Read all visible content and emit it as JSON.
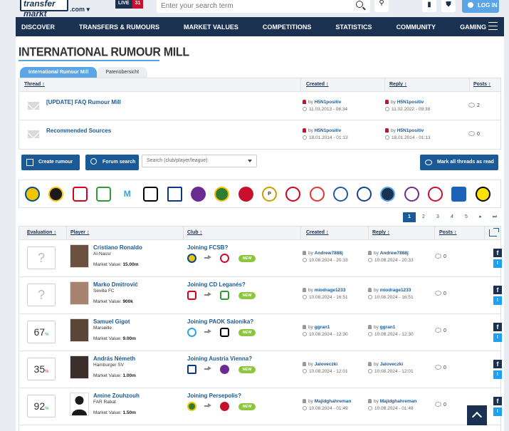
{
  "header": {
    "logo_text": "transfer markt",
    "logo_domain": ".com",
    "live_label": "LIVE",
    "live_count": "31",
    "search_placeholder": "Enter your search term",
    "login_label": "LOG IN"
  },
  "nav": [
    "DISCOVER",
    "TRANSFERS & RUMOURS",
    "MARKET VALUES",
    "COMPETITIONS",
    "STATISTICS",
    "COMMUNITY",
    "GAMING"
  ],
  "page": {
    "title": "INTERNATIONAL RUMOUR MILL",
    "tabs": [
      "International Rumour Mill",
      "Patenübersicht"
    ]
  },
  "threads": {
    "headers": [
      "Thread ↕",
      "Created ↕",
      "Reply ↕",
      "Posts ↕"
    ],
    "rows": [
      {
        "title": "[UPDATE] FAQ Rumour Mill",
        "created_by": "H5N1positiv",
        "created_at": "11.03.2013 - 06:34",
        "reply_by": "H5N1positiv",
        "reply_at": "11.02.2022 - 09:38",
        "posts": "2"
      },
      {
        "title": "Recommended Sources",
        "created_by": "H5N1positiv",
        "created_at": "18.01.2014 - 01:13",
        "reply_by": "H5N1positiv",
        "reply_at": "18.01.2014 - 01:13",
        "posts": "0"
      }
    ]
  },
  "actions": {
    "create": "Create rumour",
    "forum_search": "Forum search",
    "select_placeholder": "Search (club/player/league)",
    "mark_read": "Mark all threads as read"
  },
  "by_label": "by",
  "pager": {
    "pages": [
      "1",
      "2",
      "3",
      "4",
      "5"
    ],
    "next": "▸",
    "last": "⏭"
  },
  "rumours": {
    "headers": [
      "Evaluation ↕",
      "Player ↕",
      "Club ↕",
      "Created ↕",
      "Reply ↕",
      "Posts ↕"
    ],
    "mv_label": "Market Value:",
    "new_label": "NEW",
    "rows": [
      {
        "eval": "?",
        "name": "Cristiano Ronaldo",
        "club": "Al-Nassr",
        "mv": "15.00m",
        "joining": "Joining FCSB?",
        "created_by": "Andrew7888j",
        "created_at": "10.08.2024 - 20:33",
        "reply_by": "Andrew7888j",
        "reply_at": "10.08.2024 - 20:33",
        "posts": "0"
      },
      {
        "eval": "?",
        "name": "Marko Dmitrović",
        "club": "Sevilla FC",
        "mv": "900k",
        "joining": "Joining CD Leganés?",
        "created_by": "miodrage1233",
        "created_at": "10.08.2024 - 16:51",
        "reply_by": "miodrage1233",
        "reply_at": "10.08.2024 - 16:51",
        "posts": "0"
      },
      {
        "eval": "67",
        "name": "Samuel Gigot",
        "club": "Marseille",
        "mv": "9.00m",
        "joining": "Joining PAOK Salonika?",
        "created_by": "ggran1",
        "created_at": "10.08.2024 - 12:30",
        "reply_by": "ggran1",
        "reply_at": "10.08.2024 - 12:30",
        "posts": "0"
      },
      {
        "eval": "35",
        "name": "András Németh",
        "club": "Hamburger SV",
        "mv": "1.00m",
        "joining": "Joining Austria Vienna?",
        "created_by": "Jaloveczki",
        "created_at": "10.08.2024 - 12:01",
        "reply_by": "Jaloveczki",
        "reply_at": "10.08.2024 - 12:01",
        "posts": "0"
      },
      {
        "eval": "92",
        "name": "Amine Zouhzouh",
        "club": "FAR Rabat",
        "mv": "1.50m",
        "joining": "Joining Persepolis?",
        "created_by": "Majidghahreman",
        "created_at": "10.08.2024 - 01:49",
        "reply_by": "Majidghahreman",
        "reply_at": "10.08.2024 - 01:49",
        "posts": "0"
      }
    ]
  },
  "social": {
    "facebook": "f",
    "twitter": "t"
  }
}
